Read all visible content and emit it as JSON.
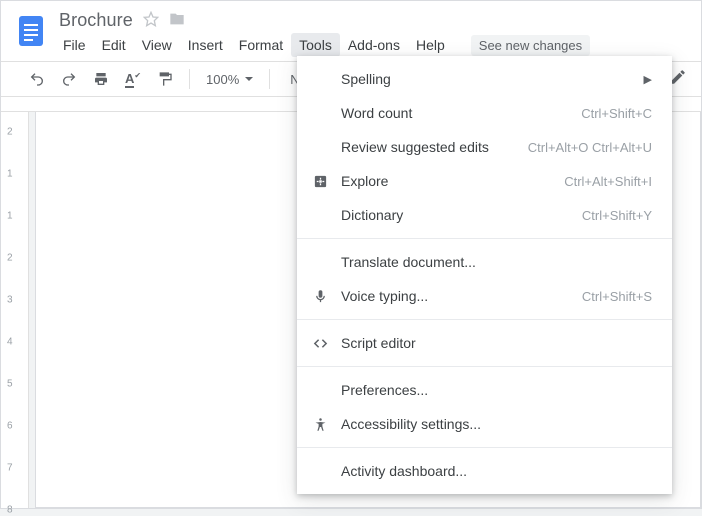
{
  "doc": {
    "title": "Brochure"
  },
  "menubar": {
    "items": [
      "File",
      "Edit",
      "View",
      "Insert",
      "Format",
      "Tools",
      "Add-ons",
      "Help"
    ],
    "active_index": 5,
    "see_changes": "See new changes"
  },
  "toolbar": {
    "zoom": "100%",
    "styles_label": "Normal..."
  },
  "ruler_v": {
    "numbers": [
      "2",
      "1",
      "1",
      "2",
      "3",
      "4",
      "5",
      "6",
      "7",
      "8"
    ]
  },
  "tools_menu": {
    "groups": [
      [
        {
          "icon": "",
          "label": "Spelling",
          "shortcut": "",
          "submenu": true
        },
        {
          "icon": "",
          "label": "Word count",
          "shortcut": "Ctrl+Shift+C"
        },
        {
          "icon": "",
          "label": "Review suggested edits",
          "shortcut": "Ctrl+Alt+O Ctrl+Alt+U"
        },
        {
          "icon": "explore",
          "label": "Explore",
          "shortcut": "Ctrl+Alt+Shift+I"
        },
        {
          "icon": "",
          "label": "Dictionary",
          "shortcut": "Ctrl+Shift+Y"
        }
      ],
      [
        {
          "icon": "",
          "label": "Translate document...",
          "shortcut": ""
        },
        {
          "icon": "mic",
          "label": "Voice typing...",
          "shortcut": "Ctrl+Shift+S"
        }
      ],
      [
        {
          "icon": "code",
          "label": "Script editor",
          "shortcut": ""
        }
      ],
      [
        {
          "icon": "",
          "label": "Preferences...",
          "shortcut": ""
        },
        {
          "icon": "accessibility",
          "label": "Accessibility settings...",
          "shortcut": ""
        }
      ],
      [
        {
          "icon": "",
          "label": "Activity dashboard...",
          "shortcut": ""
        }
      ]
    ]
  }
}
